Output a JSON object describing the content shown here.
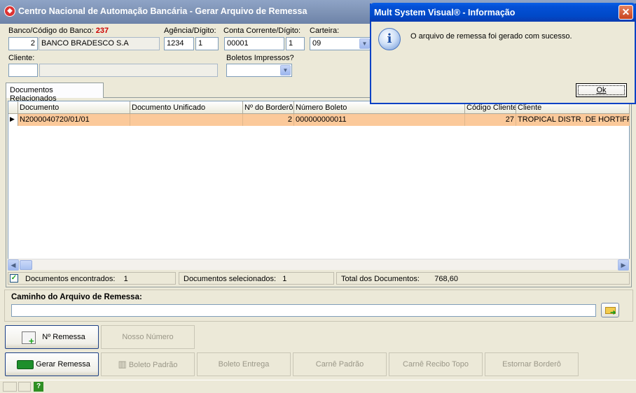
{
  "window": {
    "title": "Centro Nacional de Automação Bancária - Gerar Arquivo de Remessa"
  },
  "form": {
    "banco_label": "Banco/Código do Banco:",
    "banco_code": "237",
    "banco_num": "2",
    "banco_name": "BANCO BRADESCO S.A",
    "agencia_label": "Agência/Dígito:",
    "agencia": "1234",
    "agencia_digito": "1",
    "conta_label": "Conta Corrente/Dígito:",
    "conta": "00001",
    "conta_digito": "1",
    "carteira_label": "Carteira:",
    "carteira": "09",
    "cliente_label": "Cliente:",
    "cliente_code": "",
    "cliente_name": "",
    "boletos_label": "Boletos Impressos?",
    "boletos_value": ""
  },
  "tabs": [
    {
      "label": "Documentos Relacionados"
    }
  ],
  "grid": {
    "columns": [
      "Documento",
      "Documento Unificado",
      "Nº do Borderô",
      "Número Boleto",
      "Código Cliente",
      "Cliente"
    ],
    "rows": [
      [
        "N2000040720/01/01",
        "",
        "2",
        "000000000011",
        "27",
        "TROPICAL DISTR. DE HORTIFRUTI"
      ]
    ]
  },
  "status": {
    "encontrados_label": "Documentos encontrados:",
    "encontrados": "1",
    "selecionados_label": "Documentos selecionados:",
    "selecionados": "1",
    "total_label": "Total dos Documentos:",
    "total": "768,60"
  },
  "path": {
    "label": "Caminho do Arquivo de Remessa:",
    "value": ""
  },
  "buttons": {
    "n_remessa": "Nº Remessa",
    "nosso_numero": "Nosso Número",
    "gerar_remessa": "Gerar Remessa",
    "boleto_padrao": "Boleto Padrão",
    "boleto_entrega": "Boleto Entrega",
    "carne_padrao": "Carnê Padrão",
    "carne_recibo_topo": "Carnê Recibo Topo",
    "estornar_bordero": "Estornar Borderô"
  },
  "bottom": {
    "help": "?"
  },
  "dialog": {
    "title": "Mult System Visual® - Informação",
    "message": "O arquivo de remessa foi gerado com sucesso.",
    "ok_label": "Ok",
    "close": "✕",
    "info": "i"
  },
  "colors": {
    "selected_row": "#fbc99a",
    "dialog_title": "#0049c8",
    "code_red": "#cc0000"
  }
}
